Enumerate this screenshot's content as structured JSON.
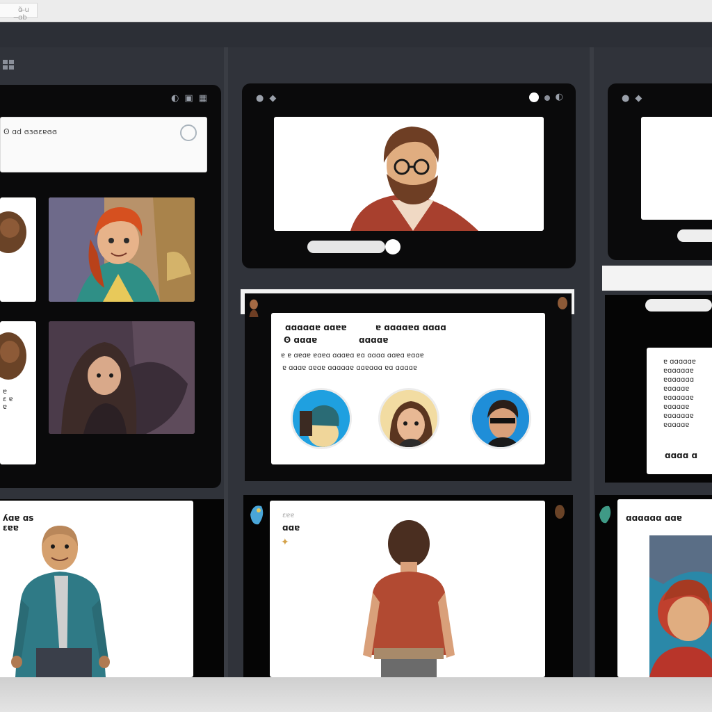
{
  "window": {
    "tab_label": "ɑ̃ ̶u ̶ɑb"
  },
  "column1": {
    "header_icon": "grid-icon",
    "search": {
      "text": "ʘ ɑd ɞɜɞɛɐɞɞ",
      "icon": "search-icon"
    },
    "bottom_card": {
      "title_lines": [
        "ʎɑɐ ɑs",
        "ɛɐɐ"
      ]
    },
    "side_card_text": [
      "ɐ",
      "ɛ ɐ",
      "ɐ"
    ]
  },
  "column2": {
    "header_icons": [
      "mic-icon",
      "chat-icon"
    ],
    "info_card": {
      "title_left": "ɑɑɑɑɑɐ ɑɑɐɐ",
      "title_right": "ɐ ɑɑɑɑɐɑ ɑɑɑɑ",
      "subtitle_left": "ʘ ɑɑɑɐ",
      "subtitle_right": "ɑɑɑɑɐ",
      "body_lines": [
        "ɐ ɐ ɑɐɑɐ ɐɑɐɑ ɑɑɑɐɑ ɐɑ ɑɑɑɑ ɑɑɐɑ ɐɑɑɐ",
        "ɐ ɑɑɑɐ ɑɐɑɐ ɑɑɑɑɑɐ ɑɑɐɑɑɑ ɐɑ ɑɑɑɑɐ"
      ]
    },
    "bottom_card": {
      "line1": "ɛɐɐ",
      "line2": "ɑɑɐ"
    }
  },
  "column3": {
    "header_icons": [
      "link-icon",
      "settings-icon"
    ],
    "text_card_lines": [
      "ɐ ɑɑɑɑɑɐ",
      "ɐɑɑɑɑɑɐ",
      "ɐɑɑɑɑɑɑ",
      "ɐɑɑɑɑɐ",
      "ɐɑɑɑɑɑɐ",
      "ɐɑɑɑɑɐ",
      "ɐɑɑɑɑɑɐ",
      "ɐɑɑɑɑɐ"
    ],
    "text_card_footer": "ɑɑɑɑ ɑ",
    "bottom_card_title": "ɑɑɑɑɑɑ ɑɑɐ"
  },
  "colors": {
    "app_bg": "#24272e",
    "column_bg": "#30333a",
    "panel_bg": "#0a0a0b",
    "card_bg": "#ffffff",
    "accent_blue": "#1fa0e0",
    "shirt_red": "#a8402e",
    "jacket_teal": "#2f7a86"
  }
}
